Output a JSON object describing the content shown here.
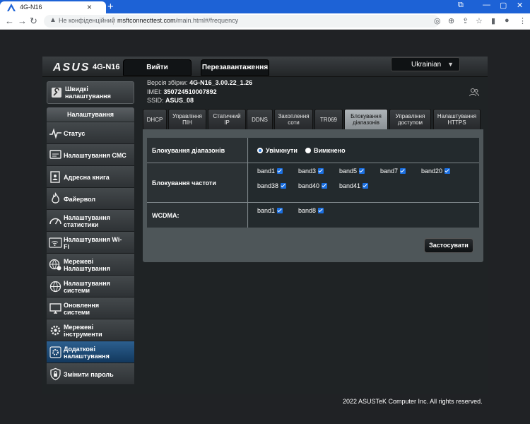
{
  "browser": {
    "tab_title": "4G-N16",
    "insecure_label": "Не конфіденційний",
    "url_host": "msftconnecttest.com",
    "url_path": "/main.html#/frequency"
  },
  "header": {
    "logo": "ASUS",
    "model": "4G-N16",
    "logout_label": "Вийти",
    "reboot_label": "Перезавантаження",
    "language": "Ukrainian"
  },
  "device": {
    "firmware_label": "Версія збірки:",
    "firmware_value": "4G-N16_3.00.22_1.26",
    "imei_label": "IMEI:",
    "imei_value": "350724510007892",
    "ssid_label": "SSID:",
    "ssid_value": "ASUS_08"
  },
  "sidebar": {
    "quick_setup_line1": "Швидкі",
    "quick_setup_line2": "налаштування",
    "settings_header": "Налаштування",
    "items": [
      {
        "line1": "Статус",
        "line2": ""
      },
      {
        "line1": "Налаштування СМС",
        "line2": ""
      },
      {
        "line1": "Адресна книга",
        "line2": ""
      },
      {
        "line1": "Файервол",
        "line2": ""
      },
      {
        "line1": "Налаштування",
        "line2": "статистики"
      },
      {
        "line1": "Налаштування Wi-",
        "line2": "Fi"
      },
      {
        "line1": "Мережеві",
        "line2": "Налаштування"
      },
      {
        "line1": "Налаштування",
        "line2": "системи"
      },
      {
        "line1": "Оновлення",
        "line2": "системи"
      },
      {
        "line1": "Мережеві",
        "line2": "інструменти"
      },
      {
        "line1": "Додаткові",
        "line2": "налаштування"
      },
      {
        "line1": "Змінити пароль",
        "line2": ""
      }
    ]
  },
  "tabs": [
    {
      "line1": "DHCP",
      "line2": ""
    },
    {
      "line1": "Управління",
      "line2": "ПІН"
    },
    {
      "line1": "Статичний",
      "line2": "IP"
    },
    {
      "line1": "DDNS",
      "line2": ""
    },
    {
      "line1": "Захоплення",
      "line2": "соти"
    },
    {
      "line1": "TR069",
      "line2": ""
    },
    {
      "line1": "Блокування",
      "line2": "діапазонів"
    },
    {
      "line1": "Управління",
      "line2": "доступом"
    },
    {
      "line1": "Налаштування",
      "line2": "HTTPS"
    }
  ],
  "form": {
    "band_lock_label": "Блокування діапазонів",
    "enabled_label": "Увімкнути",
    "disabled_label": "Вимкнено",
    "band_lock_enabled": true,
    "freq_lock_label": "Блокування частоти",
    "freq_bands": [
      "band1",
      "band3",
      "band5",
      "band7",
      "band20",
      "band38",
      "band40",
      "band41"
    ],
    "wcdma_label": "WCDMA:",
    "wcdma_bands": [
      "band1",
      "band8"
    ],
    "apply_label": "Застосувати"
  },
  "footer": "2022 ASUSTeK Computer Inc. All rights reserved.",
  "colors": {
    "chrome_accent": "#1d62d6",
    "active_sidebar": "#12385d",
    "checkbox": "#1b6fe0"
  }
}
